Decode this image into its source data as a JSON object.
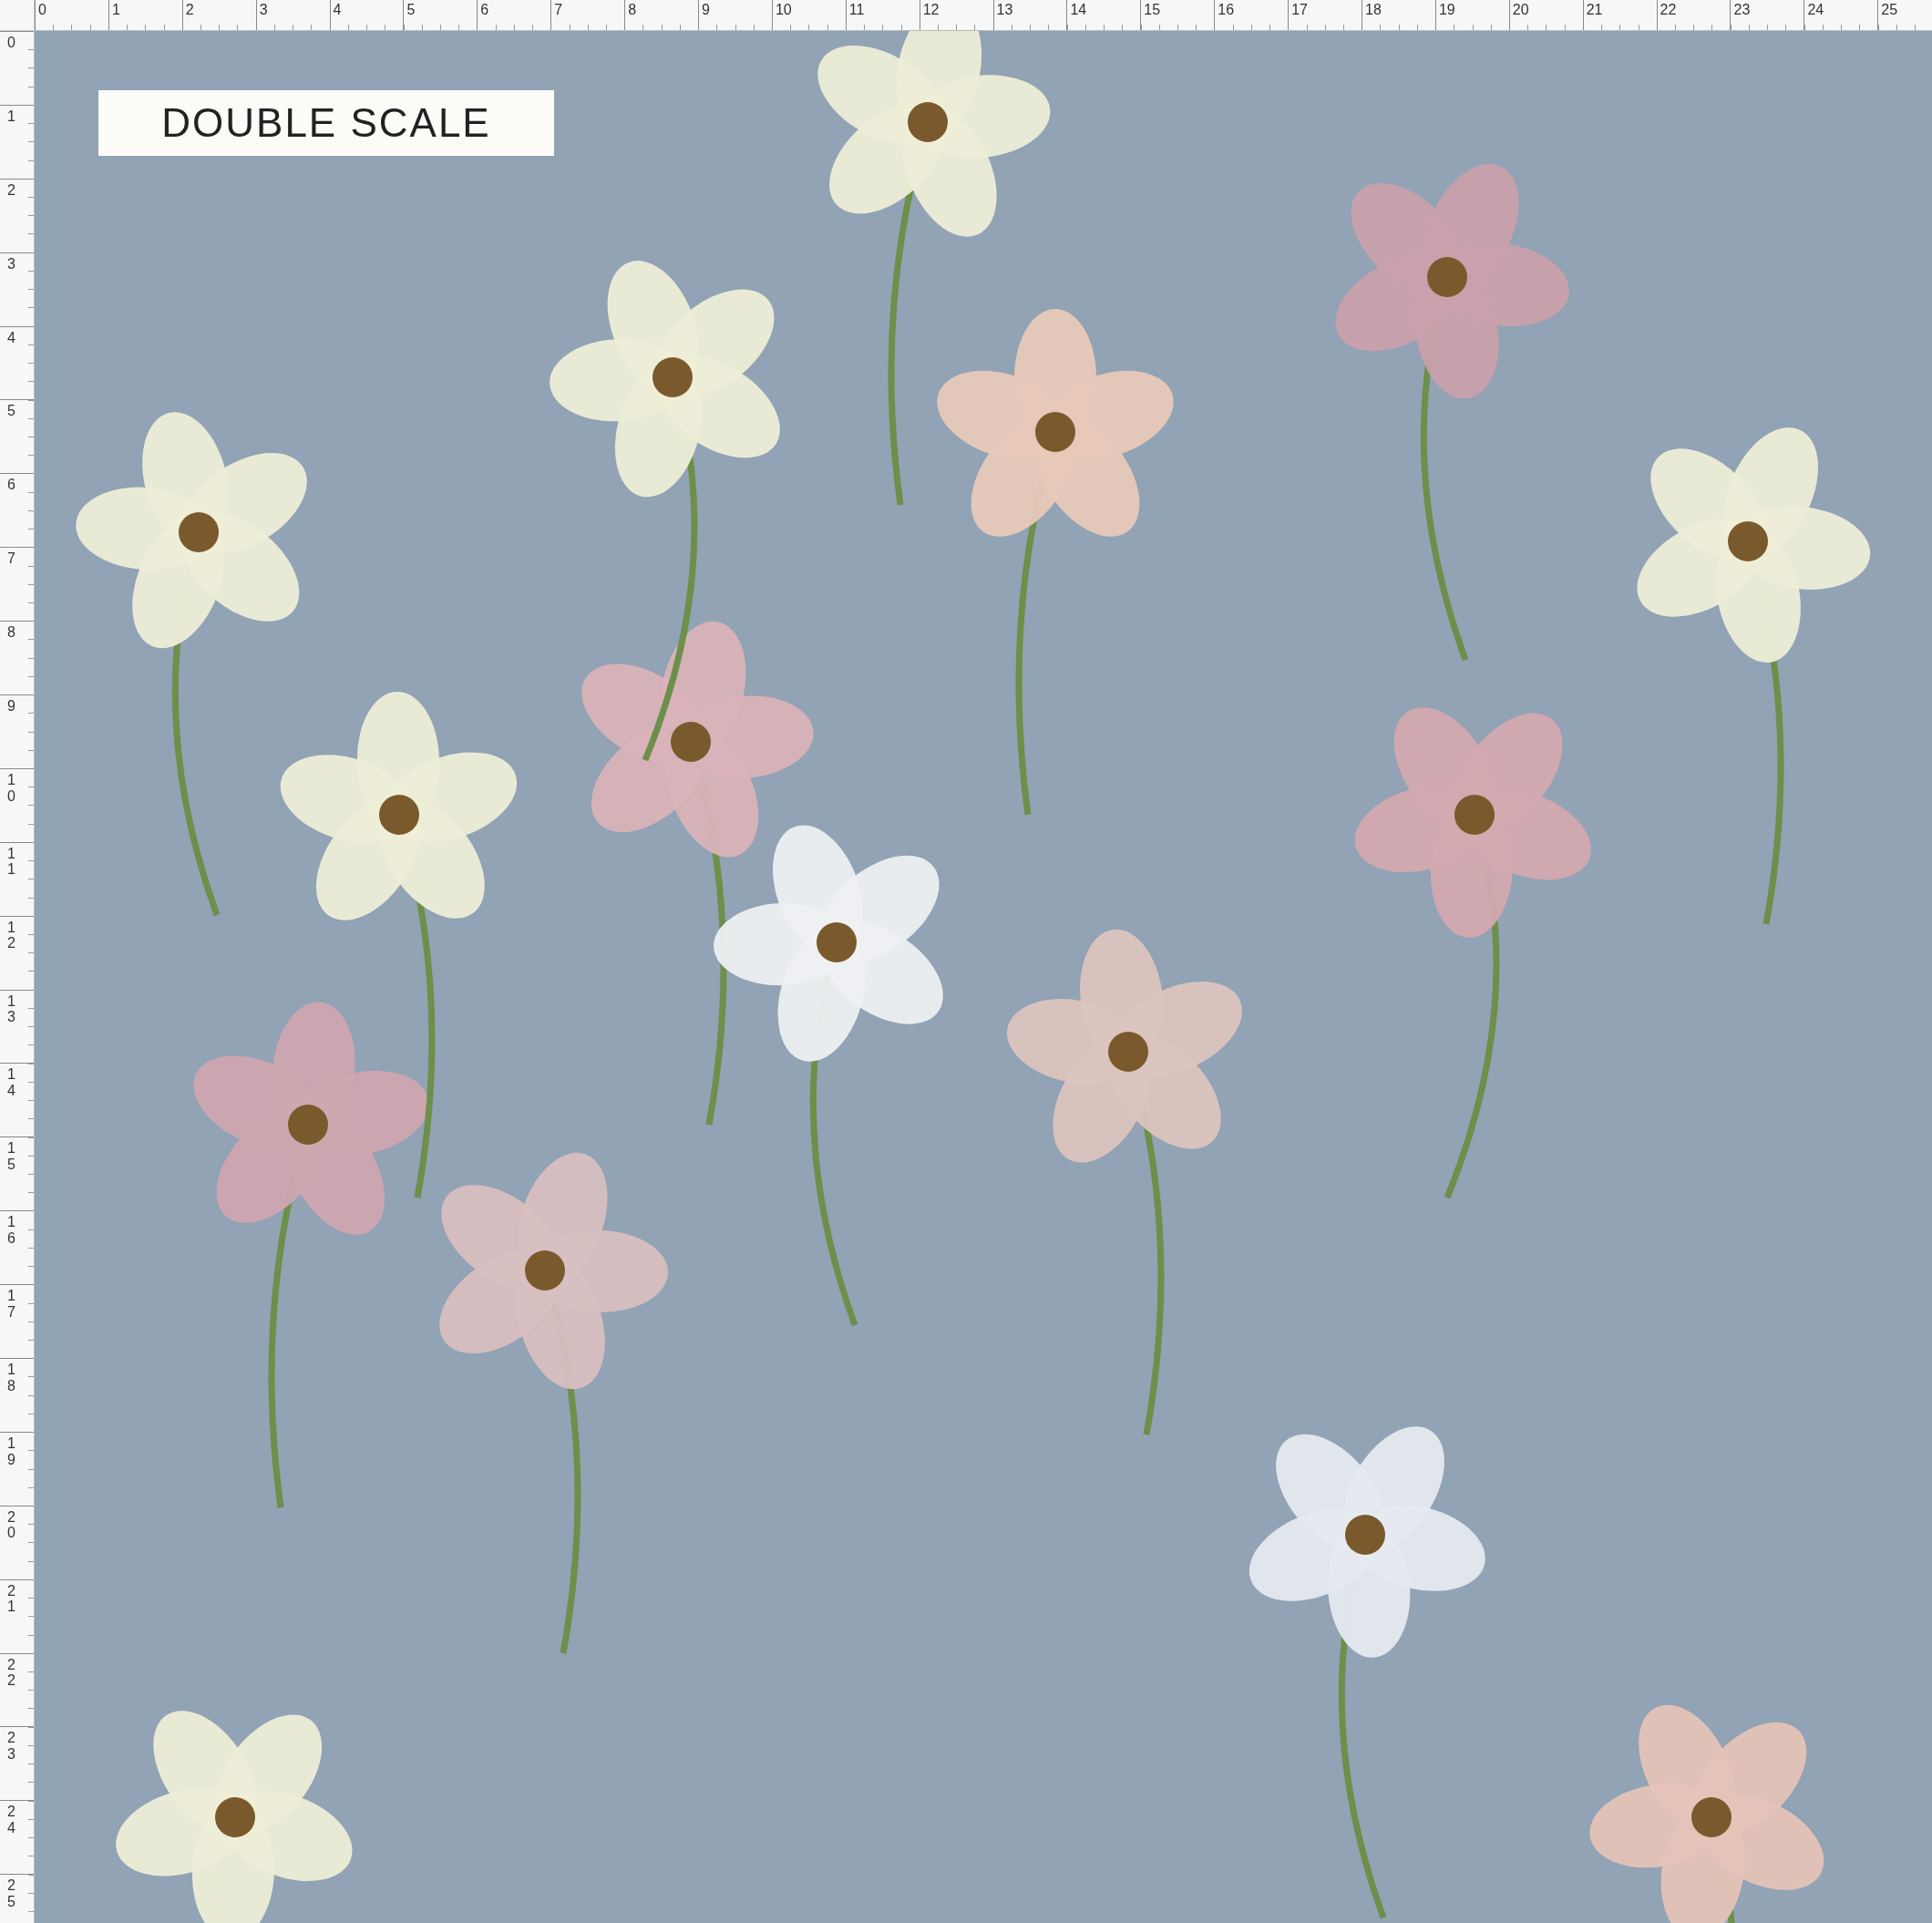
{
  "top_ruler": {
    "marks": [
      "0",
      "1",
      "2",
      "3",
      "4",
      "5",
      "6",
      "7",
      "8",
      "9",
      "10",
      "11",
      "12",
      "13",
      "14",
      "15",
      "16",
      "17",
      "18",
      "19",
      "20",
      "21",
      "22",
      "23",
      "24",
      "25"
    ]
  },
  "left_ruler": {
    "marks": [
      "0",
      "1",
      "2",
      "3",
      "4",
      "5",
      "6",
      "7",
      "8",
      "9",
      "10",
      "11",
      "12",
      "13",
      "14",
      "15",
      "16",
      "17",
      "18",
      "19",
      "20",
      "21",
      "22",
      "23",
      "24",
      "25"
    ]
  },
  "canvas": {
    "label": "DOUBLE SCALE"
  }
}
